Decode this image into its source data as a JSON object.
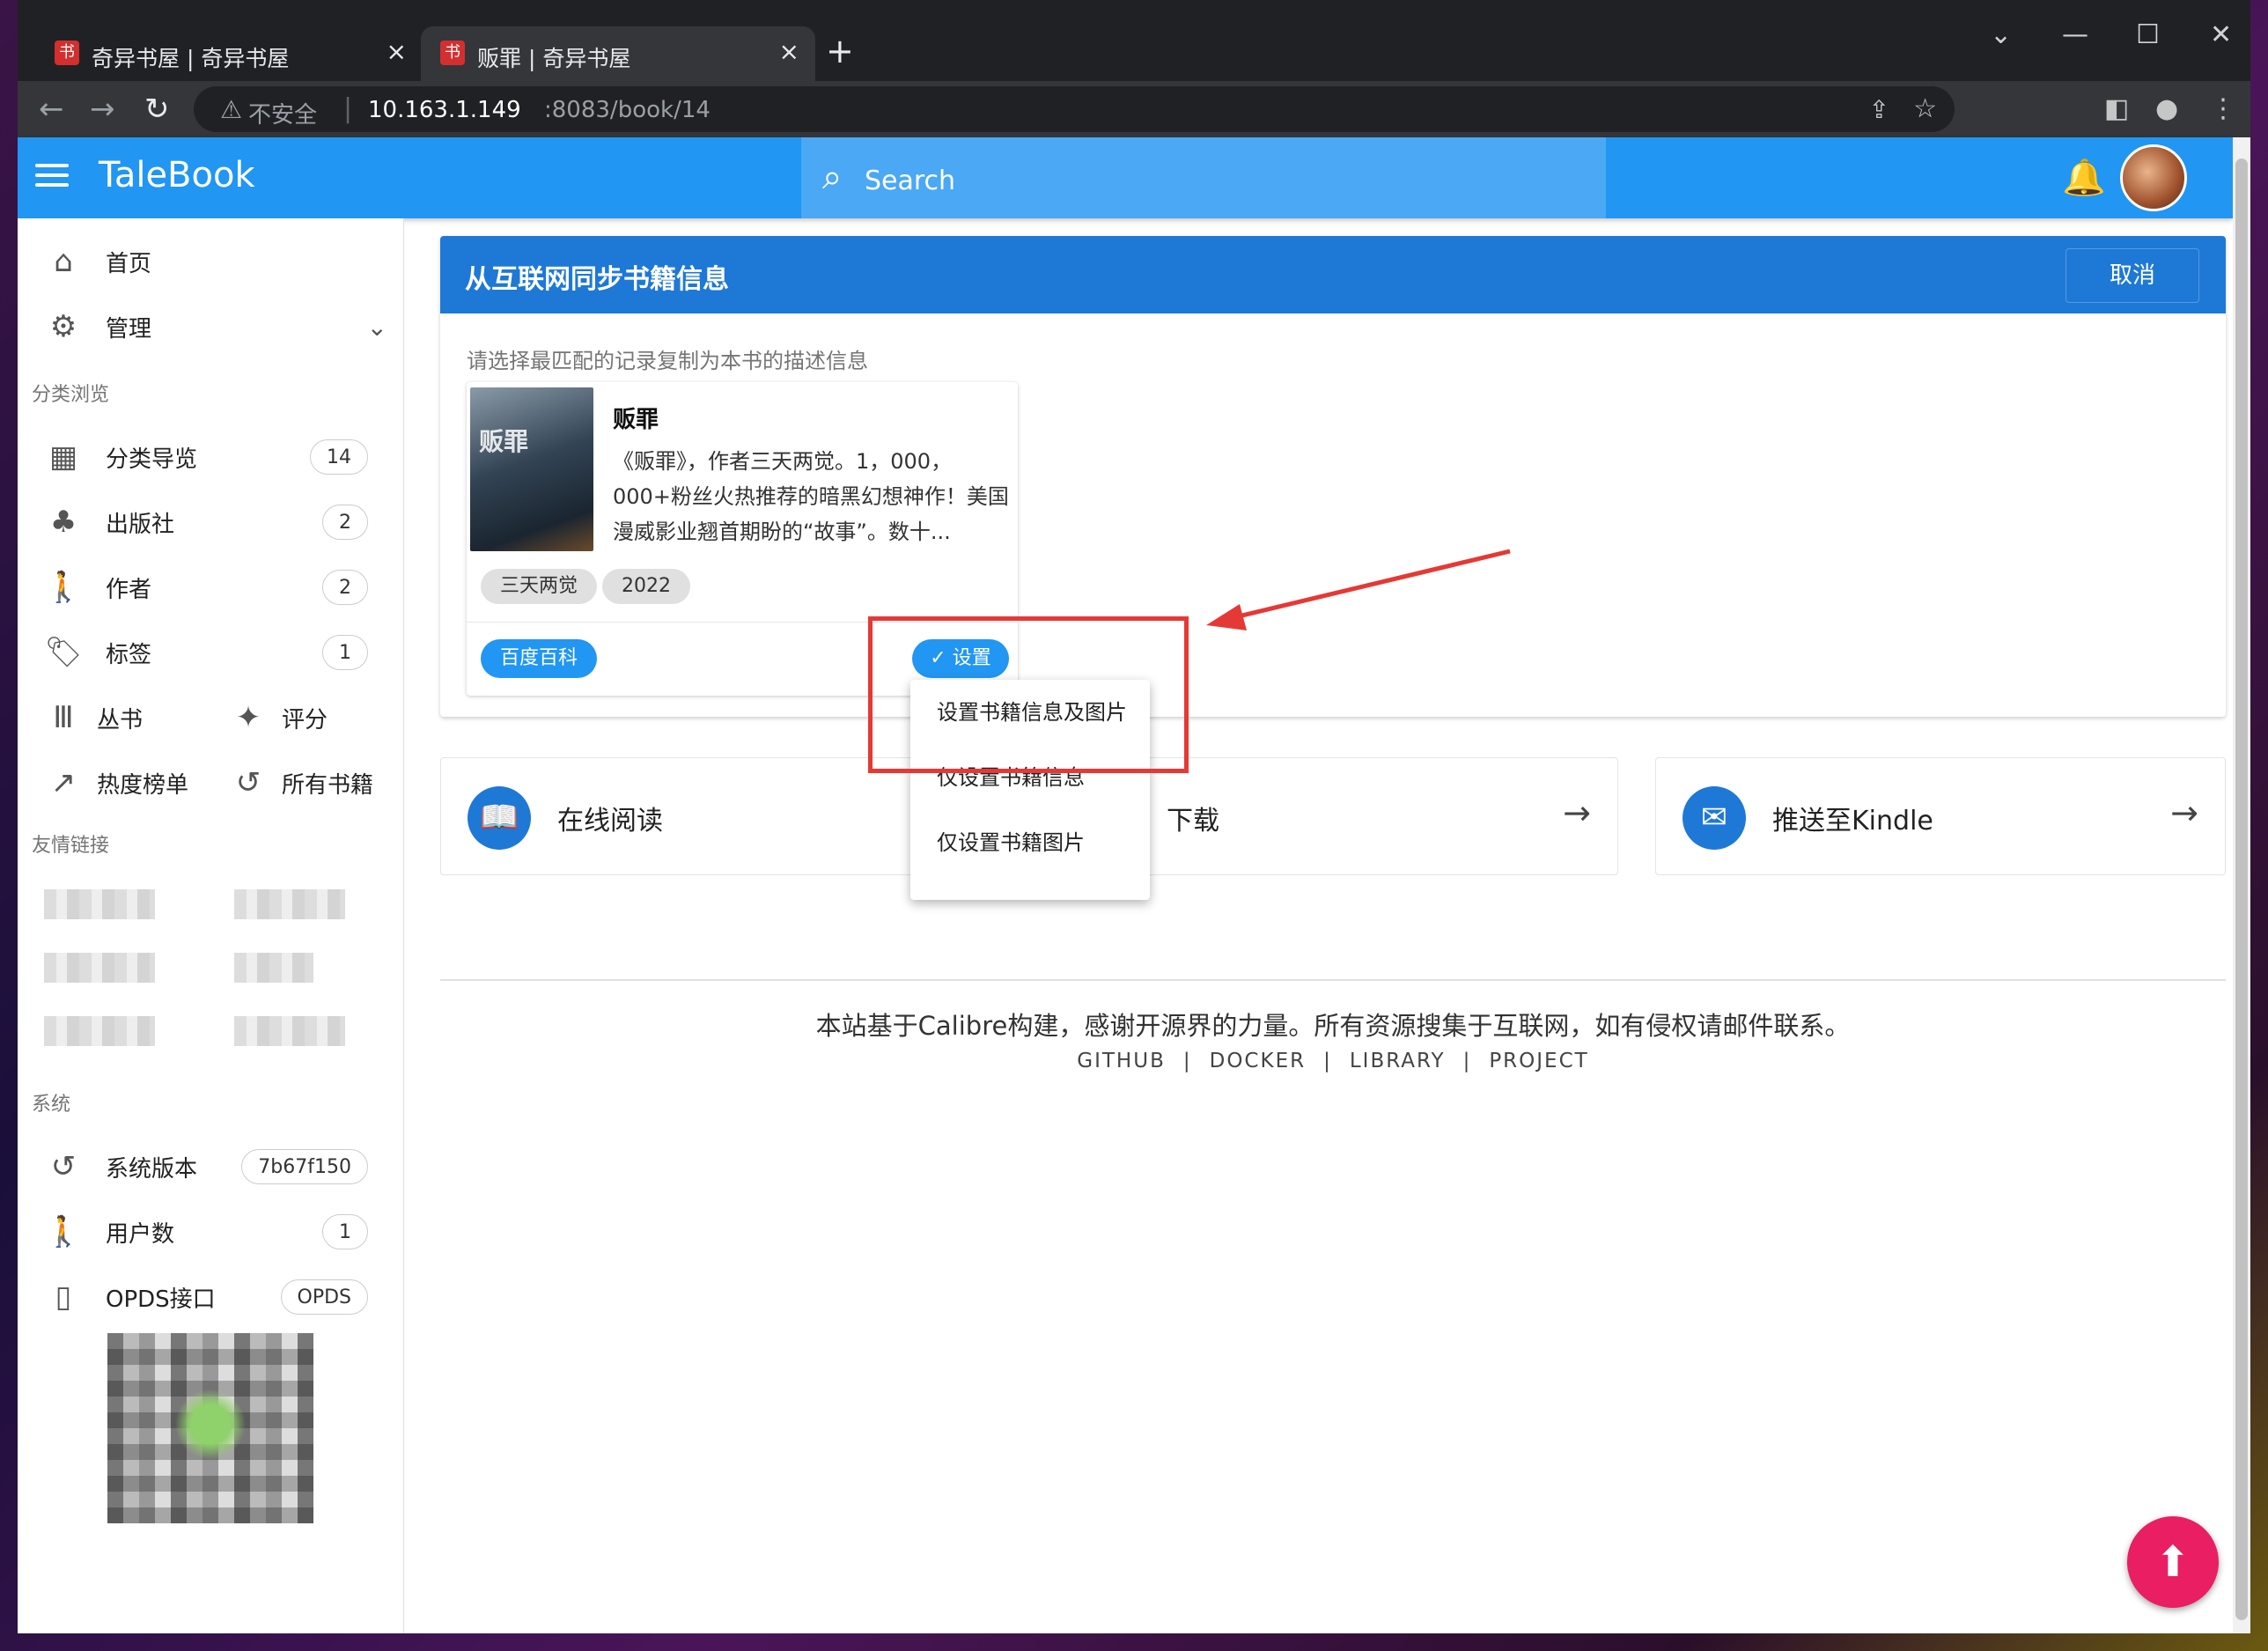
{
  "browser": {
    "tabs": [
      {
        "title": "奇异书屋 | 奇异书屋",
        "favicon": "书"
      },
      {
        "title": "贩罪 | 奇异书屋",
        "favicon": "书"
      }
    ],
    "security_label": "不安全",
    "url_host": "10.163.1.149",
    "url_path": ":8083/book/14"
  },
  "app": {
    "brand": "TaleBook",
    "search_placeholder": "Search"
  },
  "sidebar": {
    "home": "首页",
    "manage": "管理",
    "section_browse": "分类浏览",
    "category_nav": "分类导览",
    "category_count": "14",
    "publisher": "出版社",
    "publisher_count": "2",
    "author": "作者",
    "author_count": "2",
    "tags": "标签",
    "tags_count": "1",
    "series": "丛书",
    "rating": "评分",
    "hot": "热度榜单",
    "all_books": "所有书籍",
    "section_links": "友情链接",
    "section_system": "系统",
    "version": "系统版本",
    "version_value": "7b67f150",
    "users": "用户数",
    "users_count": "1",
    "opds": "OPDS接口",
    "opds_badge": "OPDS"
  },
  "sync_dialog": {
    "title": "从互联网同步书籍信息",
    "cancel": "取消",
    "instruction": "请选择最匹配的记录复制为本书的描述信息",
    "result": {
      "title": "贩罪",
      "description": "《贩罪》，作者三天两觉。1，000，000+粉丝火热推荐的暗黑幻想神作！美国漫威影业翘首期盼的“故事”。数十...",
      "chips": [
        "三天两觉",
        "2022"
      ],
      "source": "百度百科",
      "set_button": "设置",
      "cover_text": "贩罪"
    }
  },
  "set_menu": [
    "设置书籍信息及图片",
    "仅设置书籍信息",
    "仅设置书籍图片"
  ],
  "actions": [
    {
      "label": "在线阅读"
    },
    {
      "label": "下载"
    },
    {
      "label": "推送至Kindle"
    }
  ],
  "footer": {
    "text": "本站基于Calibre构建，感谢开源界的力量。所有资源搜集于互联网，如有侵权请邮件联系。",
    "links": [
      "GITHUB",
      "DOCKER",
      "LIBRARY",
      "PROJECT"
    ]
  },
  "colors": {
    "primary": "#2196f3",
    "header": "#1e78d6",
    "highlight": "#e53935",
    "fab": "#e91e63"
  }
}
